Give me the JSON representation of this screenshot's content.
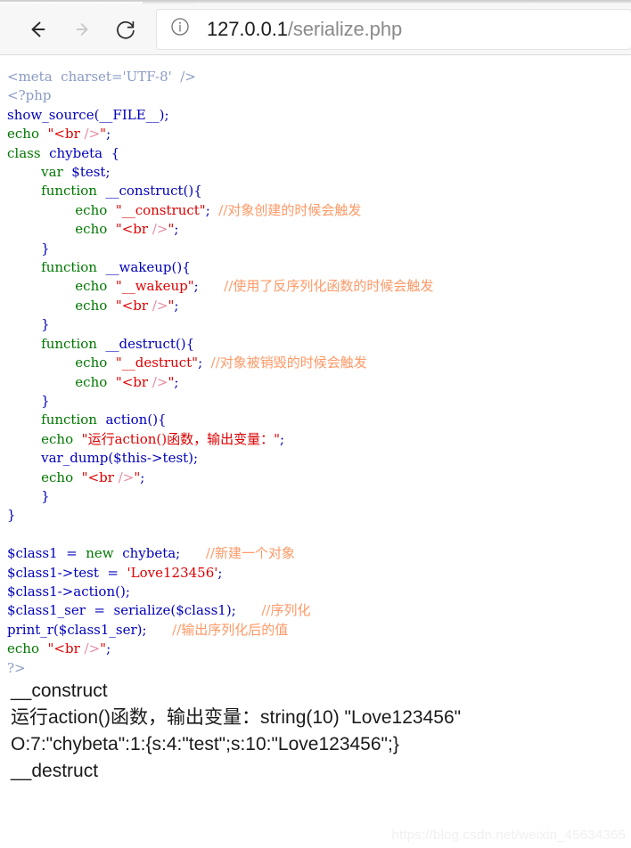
{
  "browser": {
    "back_label": "Back",
    "forward_label": "Forward",
    "reload_label": "Reload",
    "info_label": "Site information",
    "url_host": "127.0.0.1",
    "url_path": "/serialize.php"
  },
  "source": {
    "lines": [
      [
        {
          "t": "<meta  charset='UTF-8'  />",
          "c": "c-html"
        }
      ],
      [
        {
          "t": "<?php",
          "c": "c-html"
        }
      ],
      [
        {
          "t": "show_source(__FILE__);",
          "c": "c-var"
        }
      ],
      [
        {
          "t": "echo  ",
          "c": "c-kw"
        },
        {
          "t": "\"",
          "c": "c-str"
        },
        {
          "t": "<br ",
          "c": "c-str"
        },
        {
          "t": "/>",
          "c": "c-tagpink"
        },
        {
          "t": "\"",
          "c": "c-str"
        },
        {
          "t": ";",
          "c": "c-var"
        }
      ],
      [
        {
          "t": "class  ",
          "c": "c-kw"
        },
        {
          "t": "chybeta  {",
          "c": "c-var"
        }
      ],
      [
        {
          "t": "        ",
          "c": "c-var"
        },
        {
          "t": "var  ",
          "c": "c-kw"
        },
        {
          "t": "$test;",
          "c": "c-var"
        }
      ],
      [
        {
          "t": "        ",
          "c": "c-var"
        },
        {
          "t": "function  ",
          "c": "c-kw"
        },
        {
          "t": "__construct(){",
          "c": "c-var"
        }
      ],
      [
        {
          "t": "                ",
          "c": "c-var"
        },
        {
          "t": "echo  ",
          "c": "c-kw"
        },
        {
          "t": "\"__construct\"",
          "c": "c-str"
        },
        {
          "t": ";  ",
          "c": "c-var"
        },
        {
          "t": "//对象创建的时候会触发",
          "c": "c-cmt"
        }
      ],
      [
        {
          "t": "                ",
          "c": "c-var"
        },
        {
          "t": "echo  ",
          "c": "c-kw"
        },
        {
          "t": "\"",
          "c": "c-str"
        },
        {
          "t": "<br ",
          "c": "c-str"
        },
        {
          "t": "/>",
          "c": "c-tagpink"
        },
        {
          "t": "\"",
          "c": "c-str"
        },
        {
          "t": ";",
          "c": "c-var"
        }
      ],
      [
        {
          "t": "        }",
          "c": "c-var"
        }
      ],
      [
        {
          "t": "        ",
          "c": "c-var"
        },
        {
          "t": "function  ",
          "c": "c-kw"
        },
        {
          "t": "__wakeup(){",
          "c": "c-var"
        }
      ],
      [
        {
          "t": "                ",
          "c": "c-var"
        },
        {
          "t": "echo  ",
          "c": "c-kw"
        },
        {
          "t": "\"__wakeup\"",
          "c": "c-str"
        },
        {
          "t": ";      ",
          "c": "c-var"
        },
        {
          "t": "//使用了反序列化函数的时候会触发",
          "c": "c-cmt"
        }
      ],
      [
        {
          "t": "                ",
          "c": "c-var"
        },
        {
          "t": "echo  ",
          "c": "c-kw"
        },
        {
          "t": "\"",
          "c": "c-str"
        },
        {
          "t": "<br ",
          "c": "c-str"
        },
        {
          "t": "/>",
          "c": "c-tagpink"
        },
        {
          "t": "\"",
          "c": "c-str"
        },
        {
          "t": ";",
          "c": "c-var"
        }
      ],
      [
        {
          "t": "        }",
          "c": "c-var"
        }
      ],
      [
        {
          "t": "        ",
          "c": "c-var"
        },
        {
          "t": "function  ",
          "c": "c-kw"
        },
        {
          "t": "__destruct(){",
          "c": "c-var"
        }
      ],
      [
        {
          "t": "                ",
          "c": "c-var"
        },
        {
          "t": "echo  ",
          "c": "c-kw"
        },
        {
          "t": "\"__destruct\"",
          "c": "c-str"
        },
        {
          "t": ";  ",
          "c": "c-var"
        },
        {
          "t": "//对象被销毁的时候会触发",
          "c": "c-cmt"
        }
      ],
      [
        {
          "t": "                ",
          "c": "c-var"
        },
        {
          "t": "echo  ",
          "c": "c-kw"
        },
        {
          "t": "\"",
          "c": "c-str"
        },
        {
          "t": "<br ",
          "c": "c-str"
        },
        {
          "t": "/>",
          "c": "c-tagpink"
        },
        {
          "t": "\"",
          "c": "c-str"
        },
        {
          "t": ";",
          "c": "c-var"
        }
      ],
      [
        {
          "t": "        }",
          "c": "c-var"
        }
      ],
      [
        {
          "t": "        ",
          "c": "c-var"
        },
        {
          "t": "function  ",
          "c": "c-kw"
        },
        {
          "t": "action(){",
          "c": "c-var"
        }
      ],
      [
        {
          "t": "        ",
          "c": "c-var"
        },
        {
          "t": "echo  ",
          "c": "c-kw"
        },
        {
          "t": "\"运行action()函数，输出变量：\"",
          "c": "c-str"
        },
        {
          "t": ";",
          "c": "c-var"
        }
      ],
      [
        {
          "t": "        var_dump($this->test);",
          "c": "c-var"
        }
      ],
      [
        {
          "t": "        ",
          "c": "c-var"
        },
        {
          "t": "echo  ",
          "c": "c-kw"
        },
        {
          "t": "\"",
          "c": "c-str"
        },
        {
          "t": "<br ",
          "c": "c-str"
        },
        {
          "t": "/>",
          "c": "c-tagpink"
        },
        {
          "t": "\"",
          "c": "c-str"
        },
        {
          "t": ";",
          "c": "c-var"
        }
      ],
      [
        {
          "t": "        }",
          "c": "c-var"
        }
      ],
      [
        {
          "t": "}",
          "c": "c-var"
        }
      ],
      [
        {
          "t": "",
          "c": "c-var"
        }
      ],
      [
        {
          "t": "$class1  =  ",
          "c": "c-var"
        },
        {
          "t": "new  ",
          "c": "c-kw"
        },
        {
          "t": "chybeta;      ",
          "c": "c-var"
        },
        {
          "t": "//新建一个对象",
          "c": "c-cmt"
        }
      ],
      [
        {
          "t": "$class1->test  =  ",
          "c": "c-var"
        },
        {
          "t": "'Love123456'",
          "c": "c-str"
        },
        {
          "t": ";",
          "c": "c-var"
        }
      ],
      [
        {
          "t": "$class1->action();",
          "c": "c-var"
        }
      ],
      [
        {
          "t": "$class1_ser  =  serialize($class1);      ",
          "c": "c-var"
        },
        {
          "t": "//序列化",
          "c": "c-cmt"
        }
      ],
      [
        {
          "t": "print_r($class1_ser);      ",
          "c": "c-var"
        },
        {
          "t": "//输出序列化后的值",
          "c": "c-cmt"
        }
      ],
      [
        {
          "t": "echo  ",
          "c": "c-kw"
        },
        {
          "t": "\"",
          "c": "c-str"
        },
        {
          "t": "<br ",
          "c": "c-str"
        },
        {
          "t": "/>",
          "c": "c-tagpink"
        },
        {
          "t": "\"",
          "c": "c-str"
        },
        {
          "t": ";",
          "c": "c-var"
        }
      ],
      [
        {
          "t": "?>",
          "c": "c-html"
        }
      ]
    ]
  },
  "output": {
    "lines": [
      "__construct",
      "运行action()函数，输出变量：string(10) \"Love123456\"",
      "O:7:\"chybeta\":1:{s:4:\"test\";s:10:\"Love123456\";}",
      "__destruct"
    ]
  },
  "watermark": {
    "text": "https://blog.csdn.net/weixin_45634365"
  }
}
